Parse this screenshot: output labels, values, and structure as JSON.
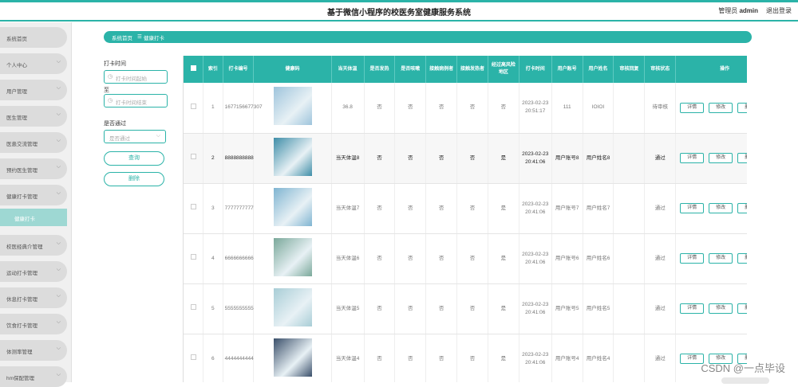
{
  "app": {
    "title": "基于微信小程序的校医务室健康服务系统",
    "user_label": "管理员",
    "user_name": "admin",
    "logout": "退出登录"
  },
  "sidebar": {
    "items": [
      {
        "label": "系统首页",
        "chevron": false
      },
      {
        "label": "个人中心",
        "chevron": true
      },
      {
        "label": "用户管理",
        "chevron": true
      },
      {
        "label": "医生管理",
        "chevron": true
      },
      {
        "label": "医患交流管理",
        "chevron": true
      },
      {
        "label": "预约医生管理",
        "chevron": true
      },
      {
        "label": "健康打卡管理",
        "chevron": true
      },
      {
        "label": "校医经典介管理",
        "chevron": true
      },
      {
        "label": "运动打卡管理",
        "chevron": true
      },
      {
        "label": "休息打卡管理",
        "chevron": true
      },
      {
        "label": "饮食打卡管理",
        "chevron": true
      },
      {
        "label": "体测率管理",
        "chevron": true
      },
      {
        "label": "hm保配管理",
        "chevron": true
      }
    ],
    "active_sub": "健康打卡"
  },
  "breadcrumb": {
    "home": "系统首页",
    "sep": "☰",
    "current": "健康打卡"
  },
  "filters": {
    "time_label": "打卡时间",
    "start_placeholder": "打卡时间起始",
    "to_label": "至",
    "end_placeholder": "打卡时间结束",
    "pass_label": "是否通过",
    "pass_placeholder": "是否通过",
    "search_button": "查询",
    "delete_button": "删除"
  },
  "table": {
    "headers": [
      "索引",
      "打卡编号",
      "健康码",
      "当天体温",
      "是否发热",
      "是否咳嗽",
      "接触病例者",
      "接触发热者",
      "经过高风险地区",
      "打卡时间",
      "用户账号",
      "用户姓名",
      "审核回复",
      "审核状态",
      "操作"
    ],
    "actions": [
      "详情",
      "修改",
      "删除"
    ],
    "rows": [
      {
        "index": "1",
        "number": "1677156677307",
        "temp": "36.8",
        "fever": "否",
        "cough": "否",
        "contact_case": "否",
        "contact_fever": "否",
        "risk": "否",
        "time": "2023-02-23 20:51:17",
        "account": "111",
        "name": "IOIOI",
        "reply": "",
        "status": "待审核",
        "highlight": false,
        "img": "#9ec4dc"
      },
      {
        "index": "2",
        "number": "8888888888",
        "temp": "当天体温8",
        "fever": "否",
        "cough": "否",
        "contact_case": "否",
        "contact_fever": "否",
        "risk": "是",
        "time": "2023-02-23 20:41:06",
        "account": "用户账号8",
        "name": "用户姓名8",
        "reply": "",
        "status": "通过",
        "highlight": true,
        "img": "#3f8ea8"
      },
      {
        "index": "3",
        "number": "7777777777",
        "temp": "当天体温7",
        "fever": "否",
        "cough": "否",
        "contact_case": "否",
        "contact_fever": "否",
        "risk": "是",
        "time": "2023-02-23 20:41:06",
        "account": "用户账号7",
        "name": "用户姓名7",
        "reply": "",
        "status": "通过",
        "highlight": false,
        "img": "#7fb4d1"
      },
      {
        "index": "4",
        "number": "6666666666",
        "temp": "当天体温6",
        "fever": "否",
        "cough": "否",
        "contact_case": "否",
        "contact_fever": "否",
        "risk": "是",
        "time": "2023-02-23 20:41:06",
        "account": "用户账号6",
        "name": "用户姓名6",
        "reply": "",
        "status": "通过",
        "highlight": false,
        "img": "#7aa89a"
      },
      {
        "index": "5",
        "number": "5555555555",
        "temp": "当天体温5",
        "fever": "否",
        "cough": "否",
        "contact_case": "否",
        "contact_fever": "否",
        "risk": "是",
        "time": "2023-02-23 20:41:06",
        "account": "用户账号5",
        "name": "用户姓名5",
        "reply": "",
        "status": "通过",
        "highlight": false,
        "img": "#a8cdd6"
      },
      {
        "index": "6",
        "number": "4444444444",
        "temp": "当天体温4",
        "fever": "否",
        "cough": "否",
        "contact_case": "否",
        "contact_fever": "否",
        "risk": "是",
        "time": "2023-02-23 20:41:06",
        "account": "用户账号4",
        "name": "用户姓名4",
        "reply": "",
        "status": "通过",
        "highlight": false,
        "img": "#3a4f6a"
      }
    ]
  },
  "watermark": "CSDN @一点毕设",
  "colors": {
    "accent": "#2bb3a8",
    "sidebar_bg": "#f0f0f0",
    "sidebar_item": "#dcdcdc",
    "sidebar_active": "#9ed8d3"
  }
}
